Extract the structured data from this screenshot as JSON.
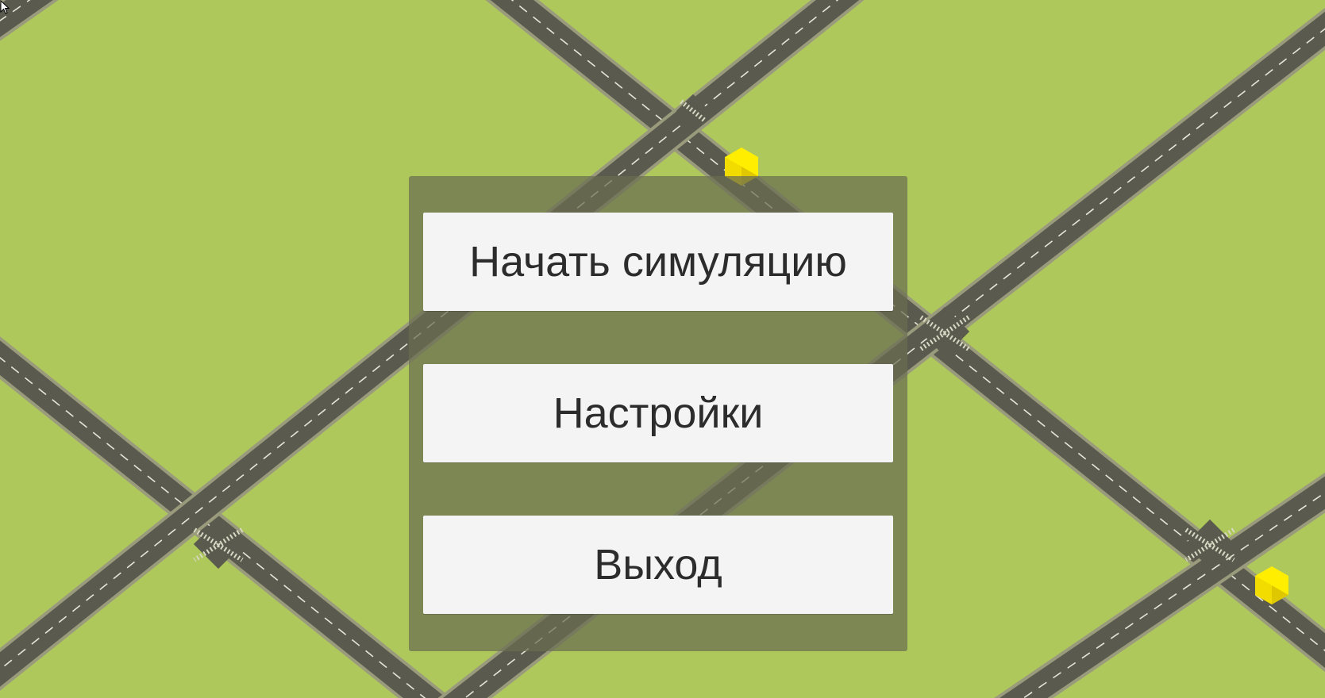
{
  "menu": {
    "start_label": "Начать симуляцию",
    "settings_label": "Настройки",
    "exit_label": "Выход"
  },
  "colors": {
    "grass": "#aec85b",
    "road": "#5a5a4e",
    "road_edge": "#9a9a7c",
    "lane_marking": "#e6e6d8",
    "vehicle": "#ffee00",
    "panel": "#696e50",
    "button": "#f4f4f4",
    "button_text": "#2c2c2c"
  },
  "icons": {
    "vehicle_markers": [
      "yellow-cube-icon",
      "yellow-cube-icon"
    ],
    "cursor": "mouse-pointer-icon"
  }
}
